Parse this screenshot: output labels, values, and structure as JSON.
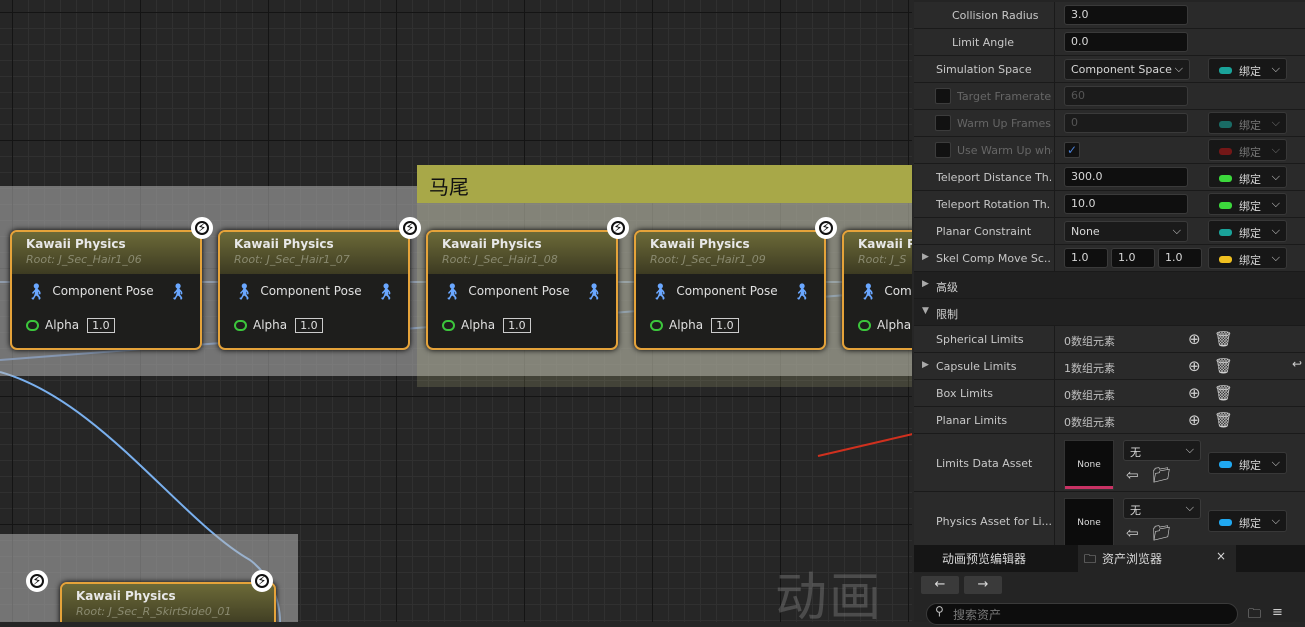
{
  "graph": {
    "comment_title": "马尾",
    "watermark": "动画",
    "nodes": [
      {
        "title": "Kawaii Physics",
        "root": "Root: J_Sec_Hair1_06",
        "pose": "Component Pose",
        "alpha_label": "Alpha",
        "alpha": "1.0"
      },
      {
        "title": "Kawaii Physics",
        "root": "Root: J_Sec_Hair1_07",
        "pose": "Component Pose",
        "alpha_label": "Alpha",
        "alpha": "1.0"
      },
      {
        "title": "Kawaii Physics",
        "root": "Root: J_Sec_Hair1_08",
        "pose": "Component Pose",
        "alpha_label": "Alpha",
        "alpha": "1.0"
      },
      {
        "title": "Kawaii Physics",
        "root": "Root: J_Sec_Hair1_09",
        "pose": "Component Pose",
        "alpha_label": "Alpha",
        "alpha": "1.0"
      },
      {
        "title": "Kawaii Ph",
        "root": "Root: J_S",
        "pose": "Comp",
        "alpha_label": "Alpha",
        "alpha": ""
      }
    ],
    "bottom_node": {
      "title": "Kawaii Physics",
      "root": "Root: J_Sec_R_SkirtSide0_01"
    }
  },
  "details": {
    "collision_radius": {
      "label": "Collision Radius",
      "value": "3.0"
    },
    "limit_angle": {
      "label": "Limit Angle",
      "value": "0.0"
    },
    "simulation_space": {
      "label": "Simulation Space",
      "value": "Component Space",
      "bind": "绑定",
      "color": "#1aa39a"
    },
    "target_framerate": {
      "label": "Target Framerate",
      "value": "60"
    },
    "warm_up_frames": {
      "label": "Warm Up Frames",
      "value": "0",
      "bind": "绑定",
      "color": "#1aa39a"
    },
    "use_warm_up": {
      "label": "Use Warm Up wher",
      "bind": "绑定",
      "color": "#b31818"
    },
    "teleport_distance": {
      "label": "Teleport Distance Th...",
      "value": "300.0",
      "bind": "绑定",
      "color": "#3cd83c"
    },
    "teleport_rotation": {
      "label": "Teleport Rotation Th...",
      "value": "10.0",
      "bind": "绑定",
      "color": "#3cd83c"
    },
    "planar_constraint": {
      "label": "Planar Constraint",
      "value": "None",
      "bind": "绑定",
      "color": "#1aa39a"
    },
    "skel_comp_move": {
      "label": "Skel Comp Move Sc...",
      "x": "1.0",
      "y": "1.0",
      "z": "1.0",
      "bind": "绑定",
      "color": "#f0c020"
    },
    "advanced_section": "高级",
    "limits_section": "限制",
    "spherical_limits": {
      "label": "Spherical Limits",
      "value": "0数组元素"
    },
    "capsule_limits": {
      "label": "Capsule Limits",
      "value": "1数组元素"
    },
    "box_limits": {
      "label": "Box Limits",
      "value": "0数组元素"
    },
    "planar_limits": {
      "label": "Planar Limits",
      "value": "0数组元素"
    },
    "limits_data_asset": {
      "label": "Limits Data Asset",
      "thumb": "None",
      "value": "无",
      "bind": "绑定",
      "color": "#20a8f0"
    },
    "physics_asset": {
      "label": "Physics Asset for Li...",
      "thumb": "None",
      "value": "无",
      "bind": "绑定",
      "color": "#20a8f0"
    }
  },
  "bottom_tabs": {
    "tab1": "动画预览编辑器",
    "tab2": "资产浏览器",
    "close": "×",
    "back": "←",
    "forward": "→",
    "search_placeholder": "搜索资产"
  }
}
